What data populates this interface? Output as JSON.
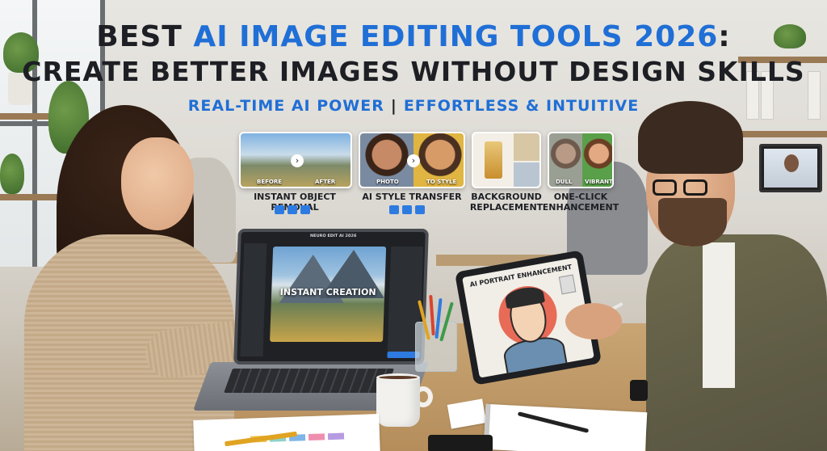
{
  "banner": {
    "title_line1_prefix": "Best ",
    "title_line1_accent": "AI Image Editing Tools 2026",
    "title_line1_suffix": ":",
    "title_line2": "Create Better Images Without Design Skills",
    "subtitle_left": "REAL-TIME AI POWER",
    "subtitle_sep": "|",
    "subtitle_right": "EFFORTLESS & INTUITIVE"
  },
  "features": [
    {
      "name": "INSTANT OBJECT REMOVAL",
      "left_caption": "BEFORE",
      "right_caption": "AFTER"
    },
    {
      "name": "AI STYLE TRANSFER",
      "left_caption": "PHOTO",
      "right_caption": "TO STYLE"
    },
    {
      "name": "BACKGROUND REPLACEMENT",
      "line1": "BACKGROUND",
      "line2": "REPLACEMENT"
    },
    {
      "name": "ONE-CLICK ENHANCEMENT",
      "line1": "ONE-CLICK",
      "line2": "ENHANCEMENT",
      "left_caption": "DULL",
      "right_caption": "VIBRANT"
    }
  ],
  "laptop": {
    "window_title": "NEURO EDIT AI 2026",
    "canvas_text": "INSTANT CREATION"
  },
  "tablet": {
    "title": "AI PORTRAIT ENHANCEMENT"
  },
  "colors": {
    "accent": "#1f6fd6",
    "title": "#1d1f24"
  }
}
